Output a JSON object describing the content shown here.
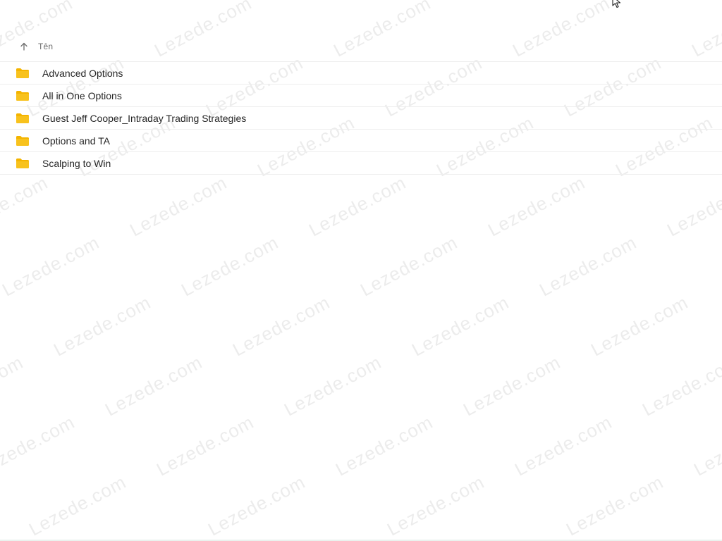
{
  "header": {
    "sort_icon": "arrow-up-icon",
    "name_column": "Tên"
  },
  "folders": [
    {
      "label": "Advanced Options",
      "icon": "folder-icon"
    },
    {
      "label": "All in One Options",
      "icon": "folder-icon"
    },
    {
      "label": "Guest Jeff Cooper_Intraday Trading Strategies",
      "icon": "folder-icon"
    },
    {
      "label": "Options and TA",
      "icon": "folder-icon"
    },
    {
      "label": "Scalping to Win",
      "icon": "folder-icon"
    }
  ],
  "watermark": {
    "text": "Lezede.com"
  },
  "colors": {
    "folder": "#f4b400",
    "folder_dark": "#e3a200",
    "divider": "#eeeeee",
    "header_text": "#6b6b6b"
  }
}
